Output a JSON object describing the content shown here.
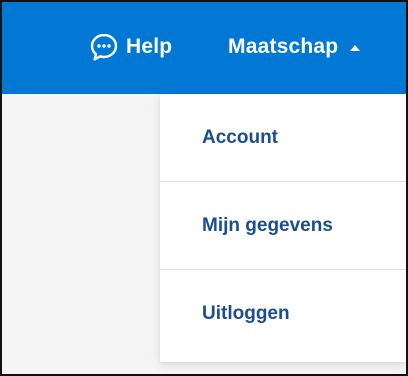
{
  "header": {
    "help_label": "Help",
    "help_icon": "chat-bubble-icon",
    "account_label": "Maatschap",
    "account_caret_icon": "caret-up-icon",
    "background_color": "#0078d4"
  },
  "dropdown": {
    "items": [
      {
        "label": "Account"
      },
      {
        "label": "Mijn gegevens"
      },
      {
        "label": "Uitloggen"
      }
    ],
    "link_color": "#1a4f8f"
  }
}
